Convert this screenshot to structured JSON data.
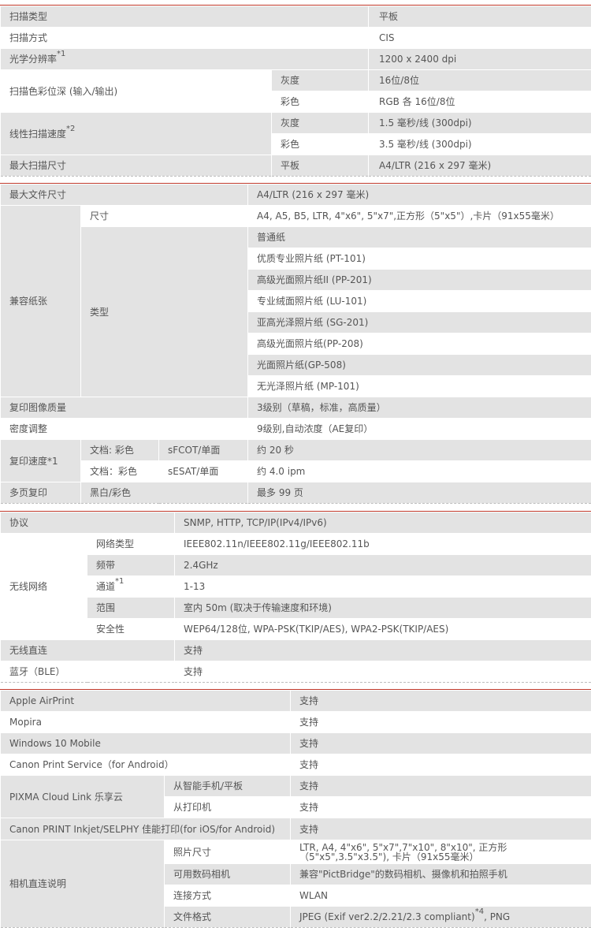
{
  "scan": {
    "type_label": "扫描类型",
    "type_value": "平板",
    "method_label": "扫描方式",
    "method_value": "CIS",
    "resolution_label": "光学分辨率",
    "resolution_note": "*1",
    "resolution_value": "1200 x 2400 dpi",
    "depth_label": "扫描色彩位深 (输入/输出)",
    "depth_gray_label": "灰度",
    "depth_gray_value": "16位/8位",
    "depth_color_label": "彩色",
    "depth_color_value": "RGB 各 16位/8位",
    "speed_label": "线性扫描速度",
    "speed_note": "*2",
    "speed_gray_label": "灰度",
    "speed_gray_value": "1.5 毫秒/线 (300dpi)",
    "speed_color_label": "彩色",
    "speed_color_value": "3.5 毫秒/线 (300dpi)",
    "max_label": "最大扫描尺寸",
    "max_sub": "平板",
    "max_value": "A4/LTR (216 x 297 毫米)"
  },
  "copy": {
    "max_doc_label": "最大文件尺寸",
    "max_doc_value": "A4/LTR (216 x 297 毫米)",
    "paper_label": "兼容纸张",
    "size_label": "尺寸",
    "size_value": "A4, A5, B5, LTR, 4\"x6\", 5\"x7\",正方形（5\"x5\"）,卡片（91x55毫米）",
    "type_label": "类型",
    "paper_types": [
      "普通纸",
      "优质专业照片纸 (PT-101)",
      "高级光面照片纸II (PP-201)",
      "专业绒面照片纸 (LU-101)",
      "亚高光泽照片纸 (SG-201)",
      "高级光面照片纸(PP-208)",
      "光面照片纸(GP-508)",
      "无光泽照片纸 (MP-101)"
    ],
    "quality_label": "复印图像质量",
    "quality_value": "3级别（草稿，标准，高质量）",
    "density_label": "密度调整",
    "density_value": "9级别,自动浓度（AE复印）",
    "speed_label": "复印速度*1",
    "speed_row1_doc": "文档: 彩色",
    "speed_row1_mode": "sFCOT/单面",
    "speed_row1_value": "约 20 秒",
    "speed_row2_doc": "文档：彩色",
    "speed_row2_mode": "sESAT/单面",
    "speed_row2_value": "约 4.0 ipm",
    "multi_label": "多页复印",
    "multi_sub": "黑白/彩色",
    "multi_value": "最多 99 页"
  },
  "network": {
    "protocol_label": "协议",
    "protocol_value": "SNMP, HTTP, TCP/IP(IPv4/IPv6)",
    "wireless_label": "无线网络",
    "net_type_label": "网络类型",
    "net_type_value": "IEEE802.11n/IEEE802.11g/IEEE802.11b",
    "band_label": "频带",
    "band_value": "2.4GHz",
    "channel_label": "通道",
    "channel_note": "*1",
    "channel_value": "1-13",
    "range_label": "范围",
    "range_value": "室内 50m (取决于传输速度和环境)",
    "security_label": "安全性",
    "security_value": "WEP64/128位, WPA-PSK(TKIP/AES), WPA2-PSK(TKIP/AES)",
    "direct_label": "无线直连",
    "direct_value": "支持",
    "bluetooth_label": "蓝牙（BLE）",
    "bluetooth_value": "支持"
  },
  "mobile": {
    "airprint_label": "Apple AirPrint",
    "airprint_value": "支持",
    "mopira_label": "Mopira",
    "mopira_value": "支持",
    "win10_label": "Windows 10 Mobile",
    "win10_value": "支持",
    "cps_label": "Canon Print Service（for Android）",
    "cps_value": "支持",
    "cloud_label": "PIXMA Cloud Link 乐享云",
    "cloud_phone_label": "从智能手机/平板",
    "cloud_phone_value": "支持",
    "cloud_printer_label": "从打印机",
    "cloud_printer_value": "支持",
    "inkjet_label": "Canon PRINT Inkjet/SELPHY 佳能打印(for iOS/for Android)",
    "inkjet_value": "支持",
    "camera_label": "相机直连说明",
    "photo_size_label": "照片尺寸",
    "photo_size_value": "LTR, A4, 4\"x6\", 5\"x7\",7\"x10\", 8\"x10\", 正方形（5\"x5\",3.5\"x3.5\"), 卡片（91x55毫米）",
    "camera_compat_label": "可用数码相机",
    "camera_compat_value": "兼容\"PictBridge\"的数码相机、摄像机和拍照手机",
    "connect_label": "连接方式",
    "connect_value": "WLAN",
    "format_label": "文件格式",
    "format_value": "JPEG (Exif ver2.2/2.21/2.3 compliant)",
    "format_note": "*4",
    "format_value_tail": ", PNG"
  },
  "colors": {
    "row_gray": "#e3e3e3",
    "section_rule": "#c0392b",
    "text": "#555555"
  }
}
